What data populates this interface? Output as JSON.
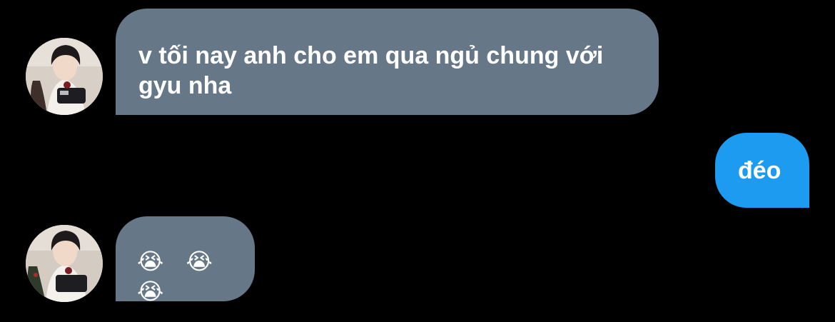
{
  "messages": [
    {
      "sender": "other",
      "text": "v tối nay anh cho em qua ngủ chung với gyu nha"
    },
    {
      "sender": "me",
      "text": "đéo"
    },
    {
      "sender": "other",
      "text": "😭 😭 😭"
    }
  ],
  "avatars": [
    {
      "icon": "profile-photo-icon"
    },
    {
      "icon": "profile-photo-icon"
    }
  ],
  "colors": {
    "background": "#000000",
    "incoming_bubble": "#667788",
    "outgoing_bubble": "#1d9bf0",
    "text": "#ffffff"
  }
}
